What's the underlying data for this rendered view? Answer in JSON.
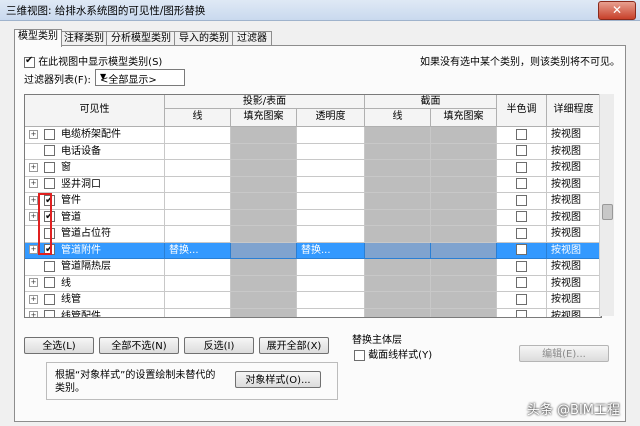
{
  "window": {
    "title": "三维视图: 给排水系统图的可见性/图形替换",
    "close": "✕"
  },
  "tabs": [
    "模型类别",
    "注释类别",
    "分析模型类别",
    "导入的类别",
    "过滤器"
  ],
  "top": {
    "show_model_label": "在此视图中显示模型类别(S)",
    "show_model_checked": true,
    "hint": "如果没有选中某个类别，则该类别将不可见。",
    "filter_label": "过滤器列表(F):",
    "filter_value": "<全部显示>"
  },
  "grid": {
    "headers": {
      "visibility": "可见性",
      "proj_surface": "投影/表面",
      "cut": "截面",
      "halftone": "半色调",
      "detail": "详细程度",
      "line": "线",
      "fill": "填充图案",
      "transparency": "透明度",
      "cut_line": "线",
      "cut_fill": "填充图案"
    },
    "rows": [
      {
        "name": "电缆桥架配件",
        "expand": "+",
        "checked": false,
        "detail": "按视图"
      },
      {
        "name": "电话设备",
        "expand": "",
        "checked": false,
        "detail": "按视图"
      },
      {
        "name": "窗",
        "expand": "+",
        "checked": false,
        "detail": "按视图"
      },
      {
        "name": "竖井洞口",
        "expand": "+",
        "checked": false,
        "detail": "按视图"
      },
      {
        "name": "管件",
        "expand": "+",
        "checked": true,
        "detail": "按视图"
      },
      {
        "name": "管道",
        "expand": "+",
        "checked": true,
        "detail": "按视图"
      },
      {
        "name": "管道占位符",
        "expand": "",
        "checked": false,
        "detail": "按视图"
      },
      {
        "name": "管道附件",
        "expand": "+",
        "checked": true,
        "detail": "按视图",
        "selected": true,
        "line_btn": "替换...",
        "transp_btn": "替换..."
      },
      {
        "name": "管道隔热层",
        "expand": "",
        "checked": false,
        "detail": "按视图"
      },
      {
        "name": "线",
        "expand": "+",
        "checked": false,
        "detail": "按视图"
      },
      {
        "name": "线管",
        "expand": "+",
        "checked": false,
        "detail": "按视图"
      },
      {
        "name": "线管配件",
        "expand": "+",
        "checked": false,
        "detail": "按视图"
      }
    ]
  },
  "buttons": {
    "select_all": "全选(L)",
    "select_none": "全部不选(N)",
    "invert": "反选(I)",
    "expand_all": "展开全部(X)",
    "object_styles": "对象样式(O)...",
    "edit": "编辑(E)..."
  },
  "override_host": {
    "title": "替换主体层",
    "cut_line_style": "截面线样式(Y)"
  },
  "note": "根据“对象样式”的设置绘制未替代的类别。",
  "watermark": "头条 @BIM工程"
}
